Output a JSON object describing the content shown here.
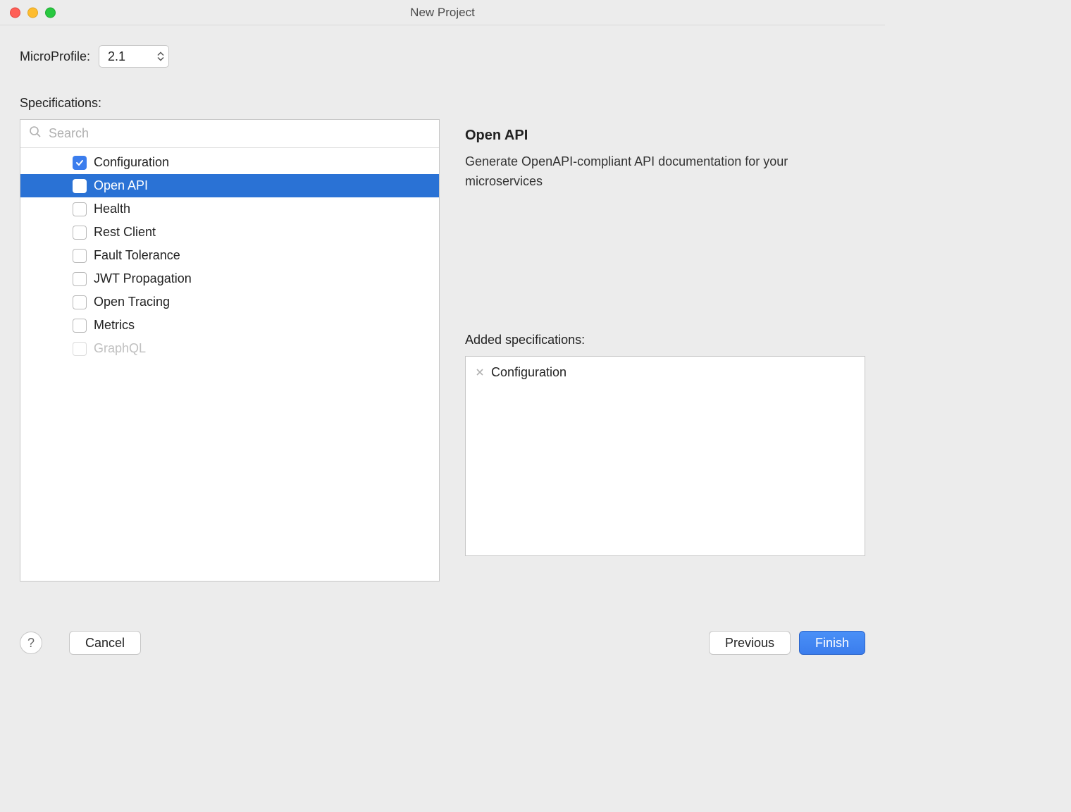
{
  "window": {
    "title": "New Project"
  },
  "mp": {
    "label": "MicroProfile:",
    "value": "2.1"
  },
  "spec_label": "Specifications:",
  "search": {
    "placeholder": "Search"
  },
  "specs": [
    {
      "label": "Configuration",
      "checked": true,
      "selected": false,
      "disabled": false
    },
    {
      "label": "Open API",
      "checked": false,
      "selected": true,
      "disabled": false
    },
    {
      "label": "Health",
      "checked": false,
      "selected": false,
      "disabled": false
    },
    {
      "label": "Rest Client",
      "checked": false,
      "selected": false,
      "disabled": false
    },
    {
      "label": "Fault Tolerance",
      "checked": false,
      "selected": false,
      "disabled": false
    },
    {
      "label": "JWT Propagation",
      "checked": false,
      "selected": false,
      "disabled": false
    },
    {
      "label": "Open Tracing",
      "checked": false,
      "selected": false,
      "disabled": false
    },
    {
      "label": "Metrics",
      "checked": false,
      "selected": false,
      "disabled": false
    },
    {
      "label": "GraphQL",
      "checked": false,
      "selected": false,
      "disabled": true
    }
  ],
  "detail": {
    "title": "Open API",
    "body": "Generate OpenAPI-compliant API documentation for your microservices"
  },
  "added": {
    "label": "Added specifications:",
    "items": [
      "Configuration"
    ]
  },
  "buttons": {
    "help": "?",
    "cancel": "Cancel",
    "previous": "Previous",
    "finish": "Finish"
  }
}
